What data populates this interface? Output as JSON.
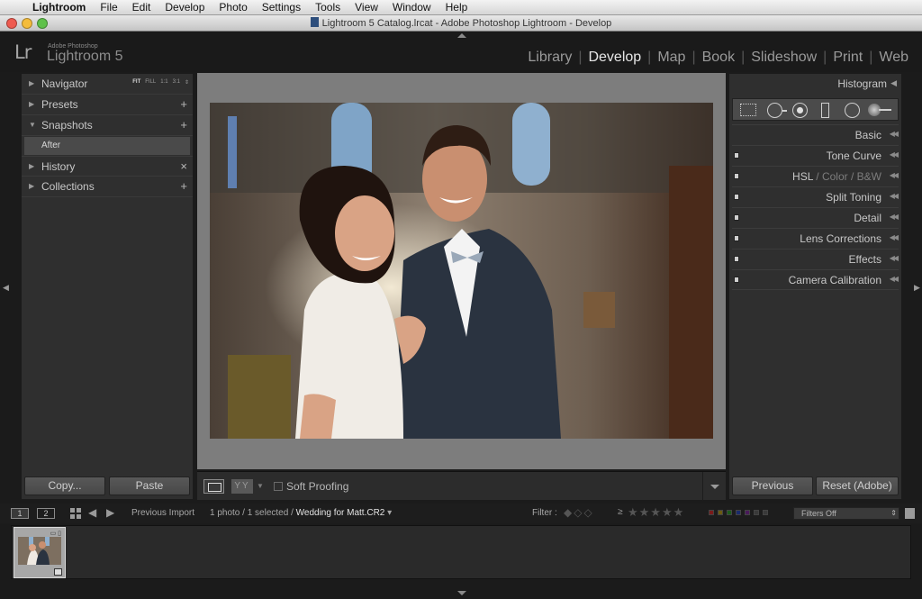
{
  "menubar": {
    "app": "Lightroom",
    "items": [
      "File",
      "Edit",
      "Develop",
      "Photo",
      "Settings",
      "Tools",
      "View",
      "Window",
      "Help"
    ]
  },
  "window": {
    "title": "Lightroom 5 Catalog.lrcat - Adobe Photoshop Lightroom - Develop"
  },
  "identity": {
    "logo": "Lr",
    "small": "Adobe Photoshop",
    "name": "Lightroom 5"
  },
  "modules": [
    "Library",
    "Develop",
    "Map",
    "Book",
    "Slideshow",
    "Print",
    "Web"
  ],
  "active_module": "Develop",
  "left_panel": {
    "navigator": {
      "label": "Navigator",
      "zoom": [
        "FIT",
        "FILL",
        "1:1",
        "3:1"
      ]
    },
    "presets": {
      "label": "Presets",
      "action": "+"
    },
    "snapshots": {
      "label": "Snapshots",
      "action": "+",
      "items": [
        "After"
      ]
    },
    "history": {
      "label": "History",
      "action": "×"
    },
    "collections": {
      "label": "Collections",
      "action": "+"
    },
    "copy_label": "Copy...",
    "paste_label": "Paste"
  },
  "toolbar": {
    "yy": "YY",
    "soft_proofing_label": "Soft Proofing"
  },
  "right_panel": {
    "histogram_label": "Histogram",
    "sections": [
      "Basic",
      "Tone Curve",
      "HSL",
      "Color",
      "B&W",
      "Split Toning",
      "Detail",
      "Lens Corrections",
      "Effects",
      "Camera Calibration"
    ],
    "previous_label": "Previous",
    "reset_label": "Reset (Adobe)"
  },
  "filmstrip_bar": {
    "monitor1": "1",
    "monitor2": "2",
    "source": "Previous Import",
    "info_prefix": "1 photo / 1 selected /",
    "filename": "Wedding for Matt.CR2",
    "filter_label": "Filter :",
    "filter_select": "Filters Off"
  },
  "icons": {
    "nav_triangle": "triangle-right",
    "open_triangle": "triangle-down",
    "stars": "★★★★★",
    "flags": "◆◇◇",
    "ge": "≥"
  }
}
